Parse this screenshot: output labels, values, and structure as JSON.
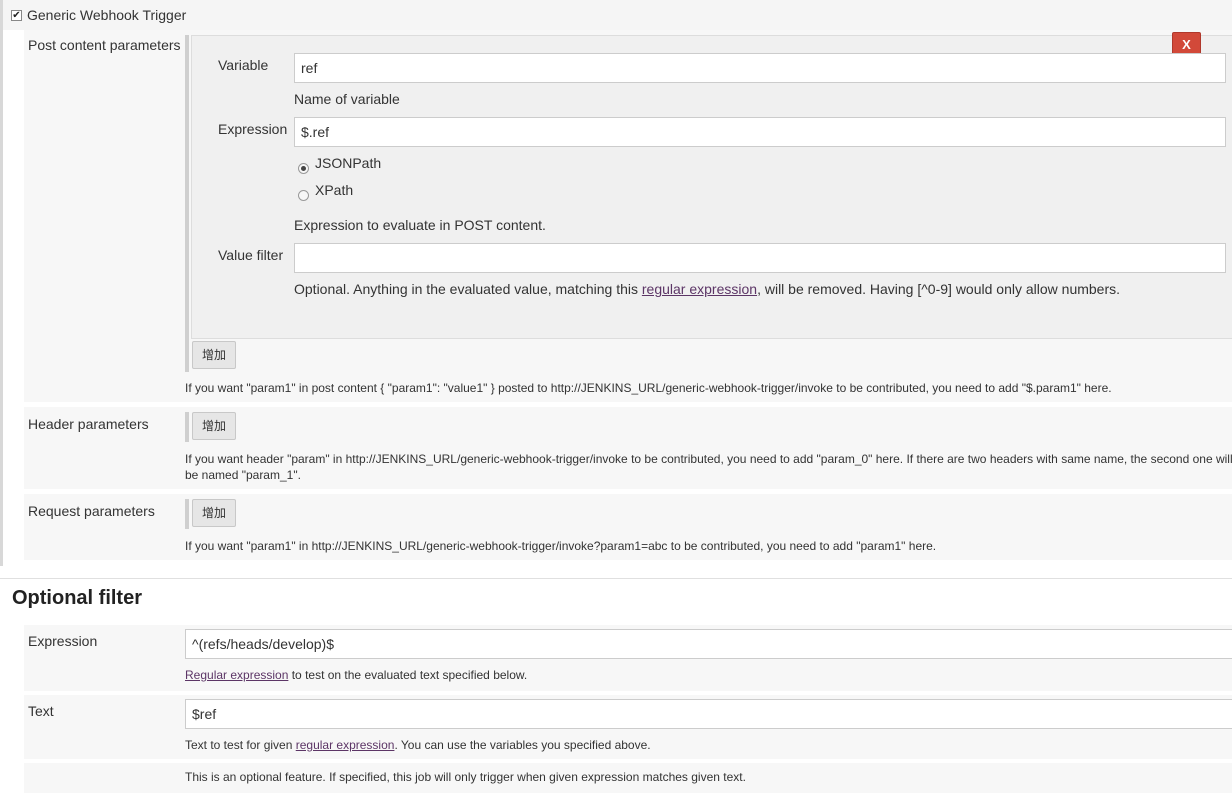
{
  "trigger": {
    "checkbox_label": "Generic Webhook Trigger",
    "checked": true
  },
  "post_content": {
    "section_label": "Post content parameters",
    "remove_label": "X",
    "variable_label": "Variable",
    "variable_value": "ref",
    "variable_help": "Name of variable",
    "expression_label": "Expression",
    "expression_value": "$.ref",
    "radio_jsonpath": "JSONPath",
    "radio_xpath": "XPath",
    "selected_radio": "JSONPath",
    "expression_help": "Expression to evaluate in POST content.",
    "value_filter_label": "Value filter",
    "value_filter_value": "",
    "value_filter_help_pre": "Optional. Anything in the evaluated value, matching this ",
    "value_filter_help_link": "regular expression",
    "value_filter_help_post": ", will be removed. Having [^0-9] would only allow numbers.",
    "add_label": "增加",
    "help": "If you want \"param1\" in post content { \"param1\": \"value1\" } posted to http://JENKINS_URL/generic-webhook-trigger/invoke to be contributed, you need to add \"$.param1\" here."
  },
  "header_params": {
    "section_label": "Header parameters",
    "add_label": "增加",
    "help_line1": "If you want header \"param\" in http://JENKINS_URL/generic-webhook-trigger/invoke to be contributed, you need to add \"param_0\" here. If there are two headers with same name, the second one will",
    "help_line2": "be named \"param_1\"."
  },
  "request_params": {
    "section_label": "Request parameters",
    "add_label": "增加",
    "help": "If you want \"param1\" in http://JENKINS_URL/generic-webhook-trigger/invoke?param1=abc to be contributed, you need to add \"param1\" here."
  },
  "optional_filter": {
    "title": "Optional filter",
    "expression_label": "Expression",
    "expression_value": "^(refs/heads/develop)$",
    "expression_help_link": "Regular expression",
    "expression_help_post": " to test on the evaluated text specified below.",
    "text_label": "Text",
    "text_value": "$ref",
    "text_help_pre": "Text to test for given ",
    "text_help_link": "regular expression",
    "text_help_post": ". You can use the variables you specified above.",
    "feature_help": "This is an optional feature. If specified, this job will only trigger when given expression matches given text."
  }
}
